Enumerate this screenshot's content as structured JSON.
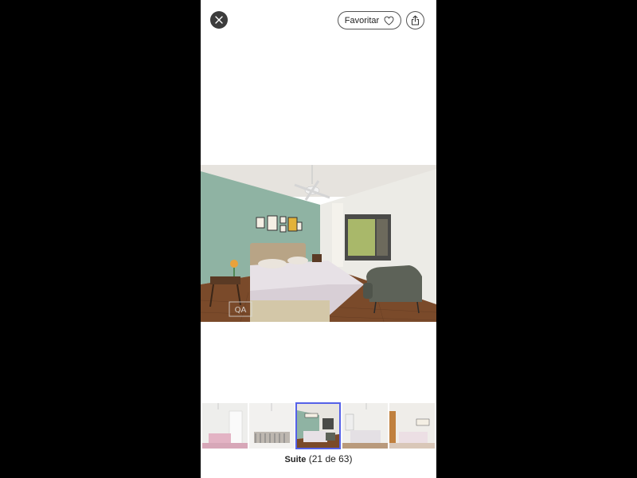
{
  "header": {
    "close_icon": "close-icon",
    "favorite_label": "Favoritar",
    "favorite_icon": "heart-icon",
    "share_icon": "share-icon"
  },
  "photo": {
    "watermark": "QA"
  },
  "thumbnails": [
    {
      "name": "thumbnail-1",
      "selected": false
    },
    {
      "name": "thumbnail-2",
      "selected": false
    },
    {
      "name": "thumbnail-3",
      "selected": true
    },
    {
      "name": "thumbnail-4",
      "selected": false
    },
    {
      "name": "thumbnail-5",
      "selected": false
    }
  ],
  "caption": {
    "title": "Suite",
    "counter": "(21 de 63)"
  },
  "colors": {
    "accent": "#5561e8",
    "background": "#000000",
    "sheet": "#ffffff"
  }
}
